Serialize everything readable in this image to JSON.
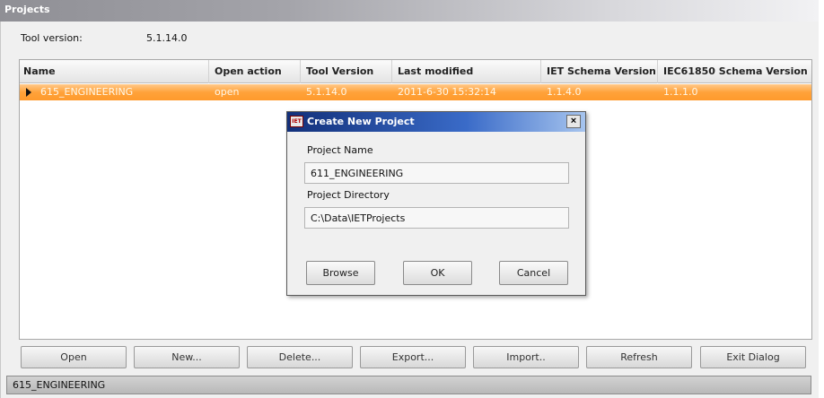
{
  "window": {
    "title": "Projects"
  },
  "tool_version": {
    "label": "Tool version:",
    "value": "5.1.14.0"
  },
  "table": {
    "columns": [
      "Name",
      "Open action",
      "Tool Version",
      "Last modified",
      "IET Schema Version",
      "IEC61850 Schema Version"
    ],
    "rows": [
      {
        "name": "615_ENGINEERING",
        "open_action": "open",
        "tool_version": "5.1.14.0",
        "last_modified": "2011-6-30 15:32:14",
        "iet_schema": "1.1.4.0",
        "iec_schema": "1.1.1.0"
      }
    ],
    "selected_row_color": "#ffa23a"
  },
  "dialog": {
    "title": "Create New Project",
    "logo_text": "IET",
    "close_glyph": "×",
    "project_name_label": "Project Name",
    "project_name_value": "611_ENGINEERING",
    "project_directory_label": "Project Directory",
    "project_directory_value": "C:\\Data\\IETProjects",
    "buttons": {
      "browse": "Browse",
      "ok": "OK",
      "cancel": "Cancel"
    }
  },
  "buttons": {
    "open": "Open",
    "new": "New...",
    "delete": "Delete...",
    "export": "Export...",
    "import": "Import..",
    "refresh": "Refresh",
    "exit": "Exit Dialog"
  },
  "status_bar": {
    "text": "615_ENGINEERING"
  }
}
